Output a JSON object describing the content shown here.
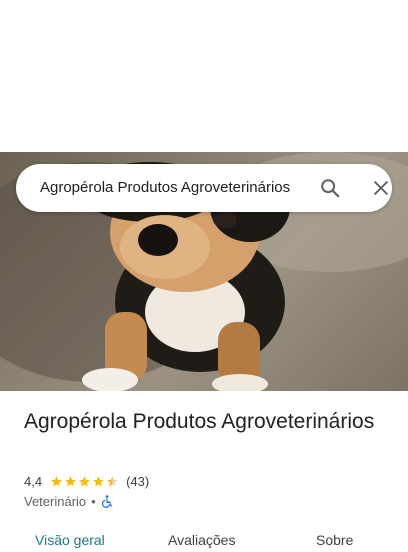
{
  "search": {
    "query": "Agropérola Produtos Agroveterinários",
    "search_icon": "search-icon",
    "close_icon": "close-icon"
  },
  "place": {
    "name": "Agropérola Produtos Agroveterinários",
    "rating": "4,4",
    "rating_value": 4.4,
    "review_count": "(43)",
    "category": "Veterinário",
    "separator": "•",
    "accessibility_icon": "wheelchair-icon"
  },
  "tabs": [
    {
      "label": "Visão geral"
    },
    {
      "label": "Avaliações"
    },
    {
      "label": "Sobre"
    }
  ],
  "colors": {
    "star": "#fbbc04",
    "accessibility": "#1a73e8",
    "active_tab": "#1a7a88"
  }
}
